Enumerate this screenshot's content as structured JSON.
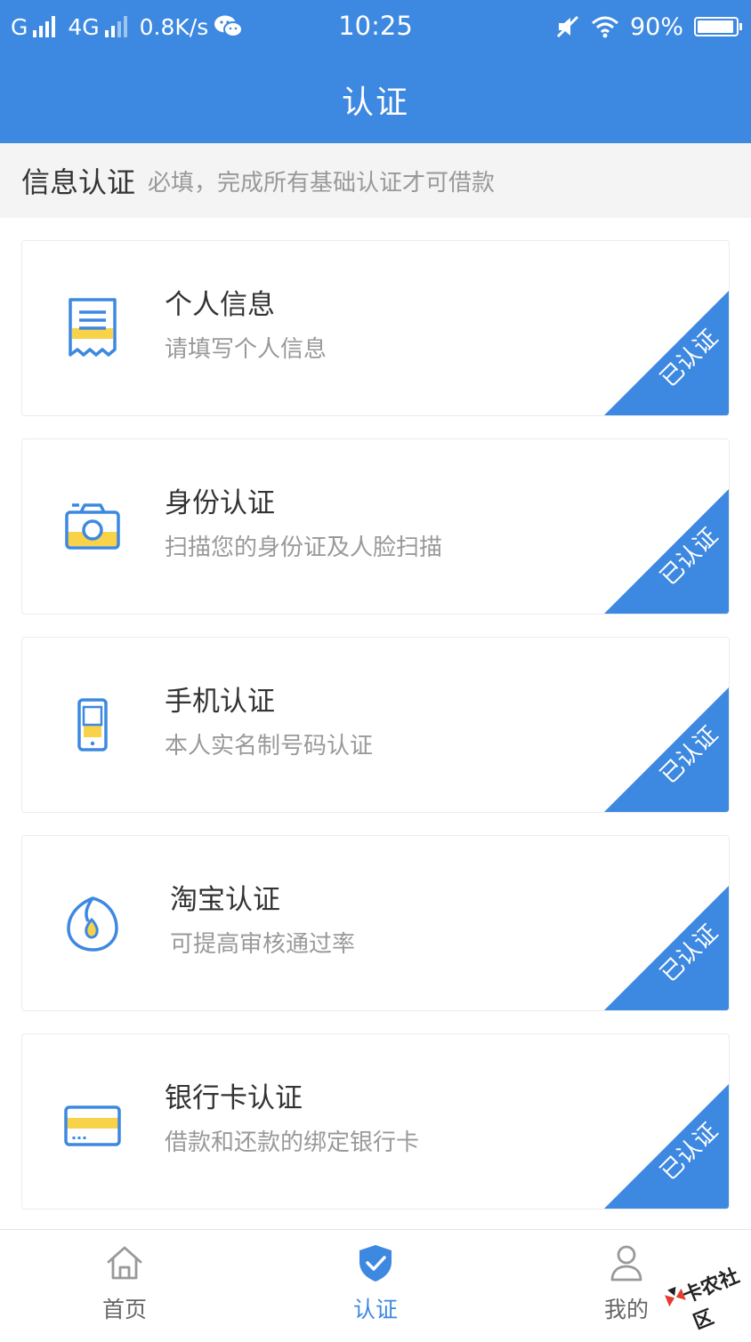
{
  "colors": {
    "primary": "#3d88e0",
    "accent_yellow": "#f8d34a",
    "text_primary": "#333333",
    "text_secondary": "#999999"
  },
  "status_bar": {
    "carrier1": "G",
    "carrier2": "4G",
    "speed": "0.8K/s",
    "time": "10:25",
    "battery": "90%"
  },
  "header": {
    "title": "认证"
  },
  "section": {
    "title": "信息认证",
    "note": "必填，完成所有基础认证才可借款"
  },
  "cards": [
    {
      "title": "个人信息",
      "subtitle": "请填写个人信息",
      "badge": "已认证",
      "icon": "document-icon"
    },
    {
      "title": "身份认证",
      "subtitle": "扫描您的身份证及人脸扫描",
      "badge": "已认证",
      "icon": "camera-icon"
    },
    {
      "title": "手机认证",
      "subtitle": "本人实名制号码认证",
      "badge": "已认证",
      "icon": "phone-icon"
    },
    {
      "title": "淘宝认证",
      "subtitle": "可提高审核通过率",
      "badge": "已认证",
      "icon": "taobao-drop-icon"
    },
    {
      "title": "银行卡认证",
      "subtitle": "借款和还款的绑定银行卡",
      "badge": "已认证",
      "icon": "bank-card-icon"
    }
  ],
  "tabbar": {
    "items": [
      {
        "label": "首页",
        "icon": "home-icon"
      },
      {
        "label": "认证",
        "icon": "shield-check-icon",
        "active": true
      },
      {
        "label": "我的",
        "icon": "user-icon"
      }
    ]
  },
  "watermark": {
    "text": "卡农社区"
  }
}
